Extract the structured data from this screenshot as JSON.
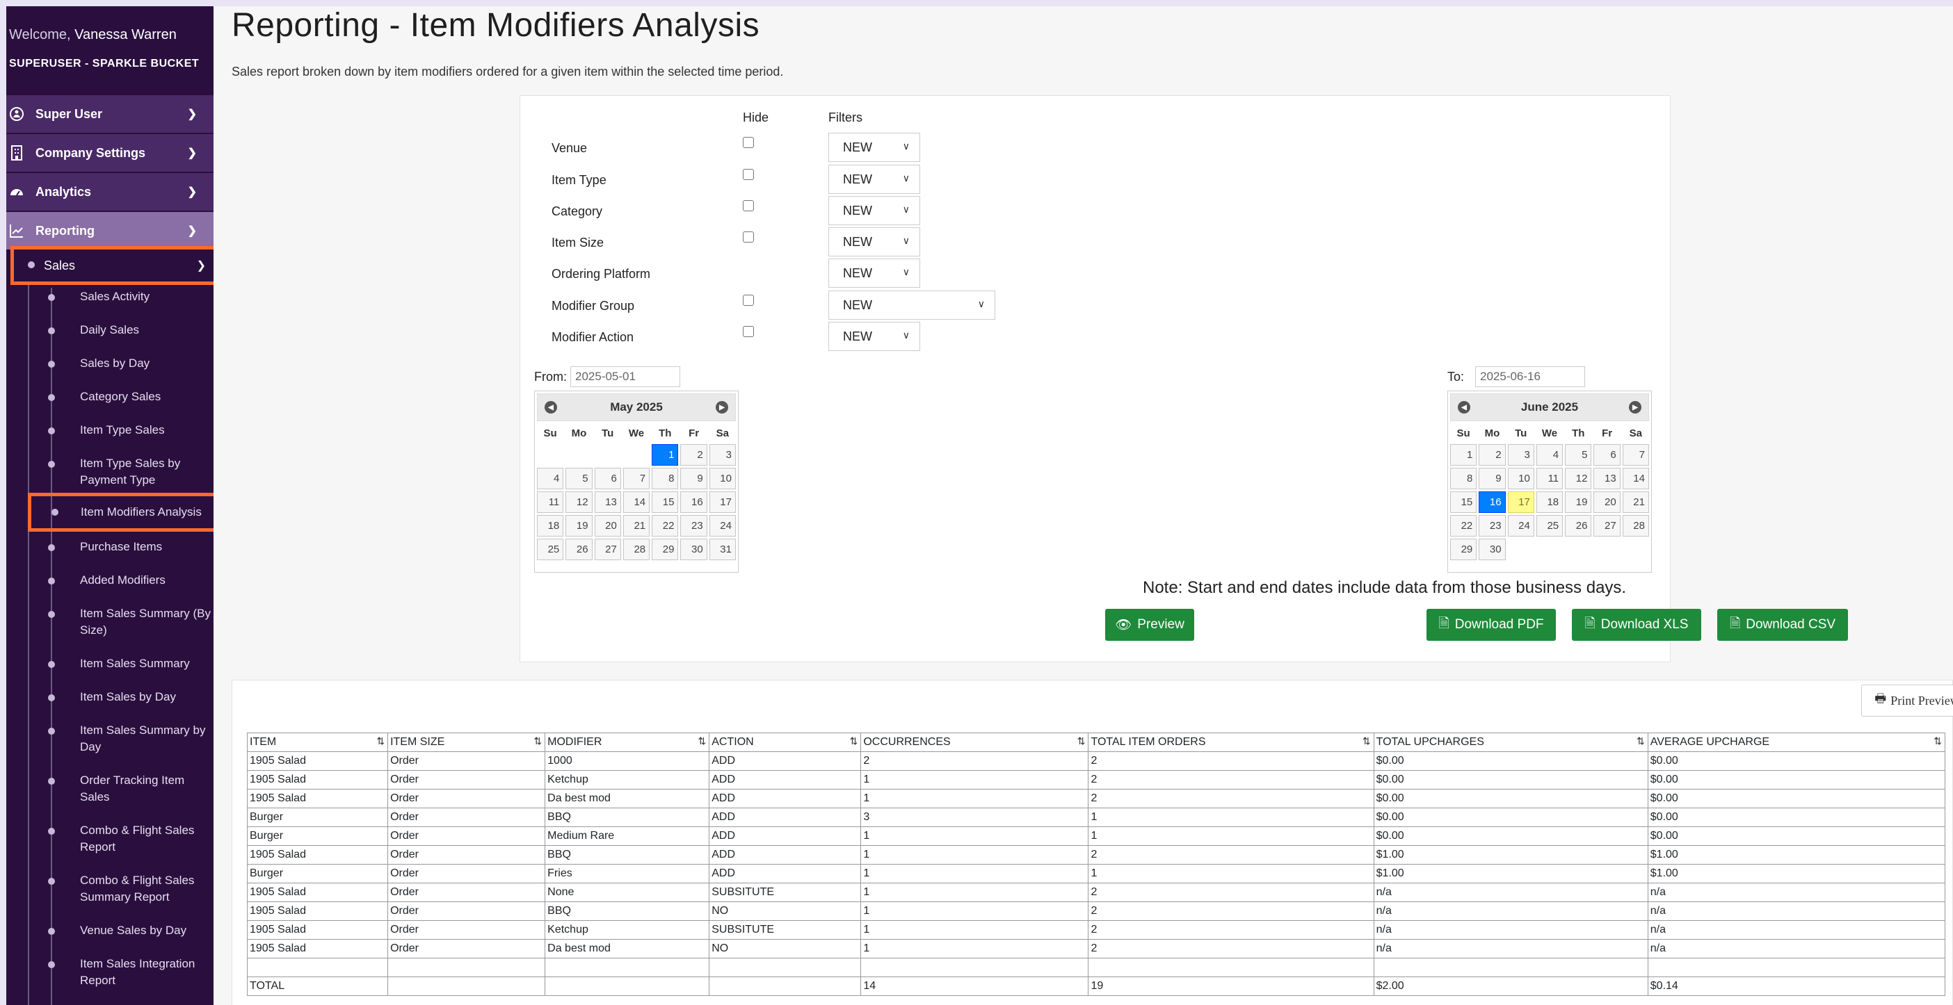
{
  "sidebar": {
    "welcome_prefix": "Welcome,",
    "user_name": "Vanessa Warren",
    "company": "SUPERUSER - SPARKLE BUCKET",
    "menu": [
      {
        "label": "Super User",
        "icon": "superuser-icon"
      },
      {
        "label": "Company Settings",
        "icon": "building-icon"
      },
      {
        "label": "Analytics",
        "icon": "dashboard-icon"
      },
      {
        "label": "Reporting",
        "icon": "line-chart-icon"
      }
    ],
    "sales_label": "Sales",
    "sales_items": [
      "Sales Activity",
      "Daily Sales",
      "Sales by Day",
      "Category Sales",
      "Item Type Sales",
      "Item Type Sales by Payment Type",
      "Item Modifiers Analysis",
      "Purchase Items",
      "Added Modifiers",
      "Item Sales Summary (By Size)",
      "Item Sales Summary",
      "Item Sales by Day",
      "Item Sales Summary by Day",
      "Order Tracking Item Sales",
      "Combo & Flight Sales Report",
      "Combo & Flight Sales Summary Report",
      "Venue Sales by Day",
      "Item Sales Integration Report"
    ]
  },
  "page": {
    "title": "Reporting - Item Modifiers Analysis",
    "description": "Sales report broken down by item modifiers ordered for a given item within the selected time period."
  },
  "filters": {
    "hide_header": "Hide",
    "filters_header": "Filters",
    "rows": [
      {
        "label": "Venue",
        "value": "NEW",
        "has_hide": true
      },
      {
        "label": "Item Type",
        "value": "NEW",
        "has_hide": true
      },
      {
        "label": "Category",
        "value": "NEW",
        "has_hide": true
      },
      {
        "label": "Item Size",
        "value": "NEW",
        "has_hide": true
      },
      {
        "label": "Ordering Platform",
        "value": "NEW",
        "has_hide": false
      },
      {
        "label": "Modifier Group",
        "value": "NEW",
        "has_hide": true
      },
      {
        "label": "Modifier Action",
        "value": "NEW",
        "has_hide": true
      }
    ]
  },
  "dates": {
    "from_label": "From:",
    "from_value": "2025-05-01",
    "to_label": "To:",
    "to_value": "2025-06-16",
    "dow": [
      "Su",
      "Mo",
      "Tu",
      "We",
      "Th",
      "Fr",
      "Sa"
    ],
    "from_month": "May 2025",
    "to_month": "June 2025",
    "from_selected": 1,
    "to_selected": 16,
    "to_today": 17,
    "note": "Note: Start and end dates include data from those business days."
  },
  "buttons": {
    "preview": "Preview",
    "pdf": "Download PDF",
    "xls": "Download XLS",
    "csv": "Download CSV",
    "print": "Print Preview"
  },
  "table": {
    "headers": [
      "ITEM",
      "ITEM SIZE",
      "MODIFIER",
      "ACTION",
      "OCCURRENCES",
      "TOTAL ITEM ORDERS",
      "TOTAL UPCHARGES",
      "AVERAGE UPCHARGE"
    ],
    "rows": [
      [
        "1905 Salad",
        "Order",
        "1000",
        "ADD",
        "2",
        "2",
        "$0.00",
        "$0.00"
      ],
      [
        "1905 Salad",
        "Order",
        "Ketchup",
        "ADD",
        "1",
        "2",
        "$0.00",
        "$0.00"
      ],
      [
        "1905 Salad",
        "Order",
        "Da best mod",
        "ADD",
        "1",
        "2",
        "$0.00",
        "$0.00"
      ],
      [
        "Burger",
        "Order",
        "BBQ",
        "ADD",
        "3",
        "1",
        "$0.00",
        "$0.00"
      ],
      [
        "Burger",
        "Order",
        "Medium Rare",
        "ADD",
        "1",
        "1",
        "$0.00",
        "$0.00"
      ],
      [
        "1905 Salad",
        "Order",
        "BBQ",
        "ADD",
        "1",
        "2",
        "$1.00",
        "$1.00"
      ],
      [
        "Burger",
        "Order",
        "Fries",
        "ADD",
        "1",
        "1",
        "$1.00",
        "$1.00"
      ],
      [
        "1905 Salad",
        "Order",
        "None",
        "SUBSITUTE",
        "1",
        "2",
        "n/a",
        "n/a"
      ],
      [
        "1905 Salad",
        "Order",
        "BBQ",
        "NO",
        "1",
        "2",
        "n/a",
        "n/a"
      ],
      [
        "1905 Salad",
        "Order",
        "Ketchup",
        "SUBSITUTE",
        "1",
        "2",
        "n/a",
        "n/a"
      ],
      [
        "1905 Salad",
        "Order",
        "Da best mod",
        "NO",
        "1",
        "2",
        "n/a",
        "n/a"
      ],
      [
        "",
        "",
        "",
        "",
        "",
        "",
        "",
        ""
      ]
    ],
    "total": [
      "TOTAL",
      "",
      "",
      "",
      "14",
      "19",
      "$2.00",
      "$0.14"
    ]
  }
}
